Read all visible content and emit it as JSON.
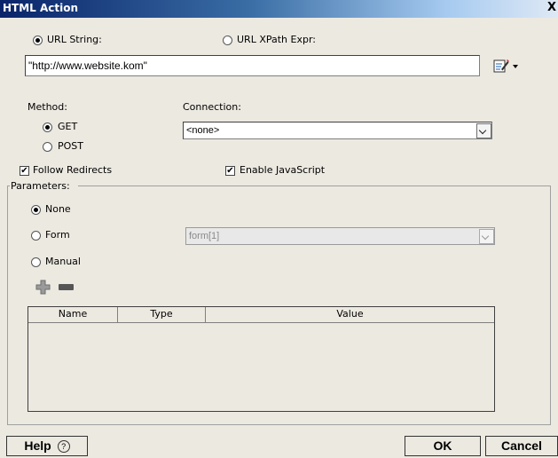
{
  "window": {
    "title": "HTML Action",
    "close_glyph": "X"
  },
  "url": {
    "mode_string_label": "URL String:",
    "mode_xpath_label": "URL XPath Expr:",
    "selected_mode": "string",
    "value": "\"http://www.website.kom\"",
    "editor_icon": "edit-expression-icon",
    "menu_icon": "dropdown-arrow-icon"
  },
  "method": {
    "label": "Method:",
    "options": [
      "GET",
      "POST"
    ],
    "selected": "GET"
  },
  "connection": {
    "label": "Connection:",
    "value": "<none>"
  },
  "options": {
    "follow_redirects_label": "Follow Redirects",
    "follow_redirects": true,
    "enable_js_label": "Enable JavaScript",
    "enable_js": true
  },
  "parameters": {
    "group_label": "Parameters:",
    "none_label": "None",
    "form_label": "Form",
    "manual_label": "Manual",
    "selected": "None",
    "form_value": "form[1]",
    "add_icon": "plus-icon",
    "remove_icon": "minus-icon",
    "columns": [
      "Name",
      "Type",
      "Value"
    ],
    "rows": []
  },
  "footer": {
    "help_label": "Help",
    "help_icon": "question-circle-icon",
    "ok_label": "OK",
    "cancel_label": "Cancel"
  },
  "colors": {
    "title_bar_start": "#0a246a",
    "title_bar_end": "#dfe9f5",
    "dialog_bg": "#ece9e1",
    "plus_icon": "#9a9a9a"
  }
}
